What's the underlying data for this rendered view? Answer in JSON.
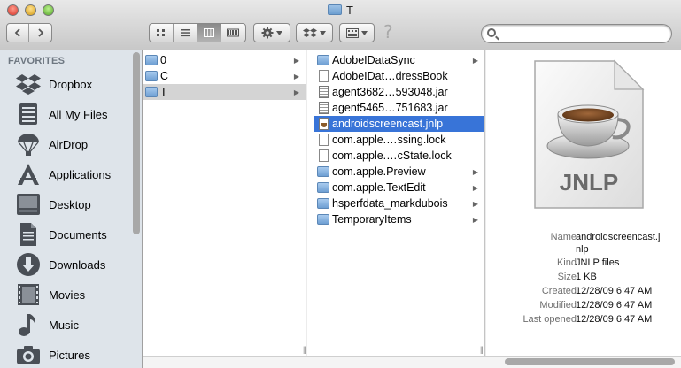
{
  "window": {
    "title": "T"
  },
  "toolbar": {
    "back_icon": "chevron-left-icon",
    "forward_icon": "chevron-right-icon",
    "views": [
      "icon-view",
      "list-view",
      "column-view",
      "coverflow-view"
    ],
    "active_view": "column-view",
    "help_symbol": "?",
    "search_value": "",
    "search_placeholder": ""
  },
  "sidebar": {
    "heading": "FAVORITES",
    "items": [
      {
        "label": "Dropbox",
        "icon": "dropbox-icon"
      },
      {
        "label": "All My Files",
        "icon": "all-files-icon"
      },
      {
        "label": "AirDrop",
        "icon": "airdrop-icon"
      },
      {
        "label": "Applications",
        "icon": "applications-icon"
      },
      {
        "label": "Desktop",
        "icon": "desktop-icon"
      },
      {
        "label": "Documents",
        "icon": "documents-icon"
      },
      {
        "label": "Downloads",
        "icon": "downloads-icon"
      },
      {
        "label": "Movies",
        "icon": "movies-icon"
      },
      {
        "label": "Music",
        "icon": "music-icon"
      },
      {
        "label": "Pictures",
        "icon": "pictures-icon"
      }
    ]
  },
  "column1": {
    "rows": [
      {
        "label": "0",
        "kind": "folder",
        "selected": false
      },
      {
        "label": "C",
        "kind": "folder",
        "selected": false
      },
      {
        "label": "T",
        "kind": "folder",
        "selected": true
      }
    ]
  },
  "column2": {
    "rows": [
      {
        "label": "AdobeIDataSync",
        "kind": "folder",
        "arrow": true
      },
      {
        "label": "AdobeIDat…dressBook",
        "kind": "doc",
        "arrow": false
      },
      {
        "label": "agent3682…593048.jar",
        "kind": "jar",
        "arrow": false
      },
      {
        "label": "agent5465…751683.jar",
        "kind": "jar",
        "arrow": false
      },
      {
        "label": "androidscreencast.jnlp",
        "kind": "jnlp",
        "arrow": false,
        "selected": true
      },
      {
        "label": "com.apple.…ssing.lock",
        "kind": "doc",
        "arrow": false
      },
      {
        "label": "com.apple.…cState.lock",
        "kind": "doc",
        "arrow": false
      },
      {
        "label": "com.apple.Preview",
        "kind": "folder",
        "arrow": true
      },
      {
        "label": "com.apple.TextEdit",
        "kind": "folder",
        "arrow": true
      },
      {
        "label": "hsperfdata_markdubois",
        "kind": "folder",
        "arrow": true
      },
      {
        "label": "TemporaryItems",
        "kind": "folder",
        "arrow": true
      }
    ]
  },
  "preview": {
    "badge": "JNLP",
    "meta": [
      {
        "key": "Name",
        "value": "androidscreencast.j",
        "value2": "nlp"
      },
      {
        "key": "Kind",
        "value": "JNLP files"
      },
      {
        "key": "Size",
        "value": "1 KB"
      },
      {
        "key": "Created",
        "value": "12/28/09 6:47 AM"
      },
      {
        "key": "Modified",
        "value": "12/28/09 6:47 AM"
      },
      {
        "key": "Last opened",
        "value": "12/28/09 6:47 AM"
      }
    ]
  }
}
